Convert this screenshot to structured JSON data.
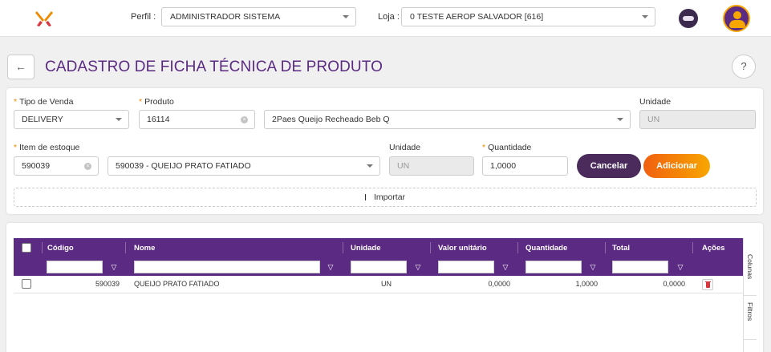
{
  "topbar": {
    "logo": "food-utensils-logo",
    "profile_label": "Perfil :",
    "profile_value": "ADMINISTRADOR SISTEMA",
    "store_label": "Loja :",
    "store_value": "0 TESTE AEROP SALVADOR [616]",
    "bot_icon": "robot-assistant-icon",
    "user_icon": "user-avatar-icon"
  },
  "header": {
    "back": "←",
    "title": "CADASTRO DE FICHA TÉCNICA DE PRODUTO",
    "help": "?"
  },
  "form": {
    "required_mark": "*",
    "tipo_venda_label": "Tipo de Venda",
    "tipo_venda_value": "DELIVERY",
    "produto_label": "Produto",
    "produto_code": "16114",
    "produto_name": "2Paes Queijo Recheado Beb Q",
    "unidade1_label": "Unidade",
    "unidade1_value": "UN",
    "item_label": "Item de estoque",
    "item_code": "590039",
    "item_name": "590039 - QUEIJO PRATO FATIADO",
    "unidade2_label": "Unidade",
    "unidade2_value": "UN",
    "quantidade_label": "Quantidade",
    "quantidade_value": "1,0000",
    "cancel_label": "Cancelar",
    "add_label": "Adicionar",
    "import_label": "Importar"
  },
  "grid": {
    "columns": [
      "Código",
      "Nome",
      "Unidade",
      "Valor unitário",
      "Quantidade",
      "Total",
      "Ações"
    ],
    "rows": [
      {
        "codigo": "590039",
        "nome": "QUEIJO PRATO FATIADO",
        "unidade": "UN",
        "valor": "0,0000",
        "quantidade": "1,0000",
        "total": "0,0000"
      }
    ],
    "side_columns": "Colunas",
    "side_filters": "Filtros"
  },
  "colors": {
    "brand": "#5b2a82",
    "accent": "#f08a00"
  }
}
